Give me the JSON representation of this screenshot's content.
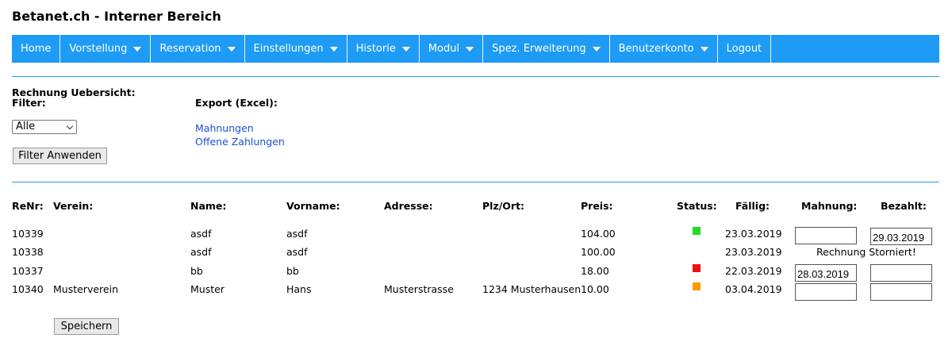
{
  "header": {
    "title": "Betanet.ch - Interner Bereich"
  },
  "nav": [
    {
      "label": "Home",
      "dropdown": false
    },
    {
      "label": "Vorstellung",
      "dropdown": true
    },
    {
      "label": "Reservation",
      "dropdown": true
    },
    {
      "label": "Einstellungen",
      "dropdown": true
    },
    {
      "label": "Historie",
      "dropdown": true
    },
    {
      "label": "Modul",
      "dropdown": true
    },
    {
      "label": "Spez. Erweiterung",
      "dropdown": true
    },
    {
      "label": "Benutzerkonto",
      "dropdown": true
    },
    {
      "label": "Logout",
      "dropdown": false
    }
  ],
  "filter": {
    "section_title": "Rechnung Uebersicht:",
    "label": "Filter:",
    "selected": "Alle",
    "apply_label": "Filter Anwenden"
  },
  "export": {
    "label": "Export (Excel):",
    "links": [
      "Mahnungen",
      "Offene Zahlungen"
    ]
  },
  "table": {
    "headers": [
      "ReNr:",
      "Verein:",
      "Name:",
      "Vorname:",
      "Adresse:",
      "Plz/Ort:",
      "Preis:",
      "Status:",
      "Fällig:",
      "Mahnung:",
      "Bezahlt:"
    ],
    "rows": [
      {
        "renr": "10339",
        "verein": "",
        "name": "asdf",
        "vorname": "asdf",
        "adresse": "",
        "plzort": "",
        "preis": "104.00",
        "status": "#22dd22",
        "faellig": "23.03.2019",
        "mahnung": "",
        "bezahlt": "29.03.2019"
      },
      {
        "renr": "10338",
        "verein": "",
        "name": "asdf",
        "vorname": "asdf",
        "adresse": "",
        "plzort": "",
        "preis": "100.00",
        "status": "",
        "faellig": "23.03.2019",
        "note": "Rechnung Storniert!"
      },
      {
        "renr": "10337",
        "verein": "",
        "name": "bb",
        "vorname": "bb",
        "adresse": "",
        "plzort": "",
        "preis": "18.00",
        "status": "#ee1111",
        "faellig": "22.03.2019",
        "mahnung": "28.03.2019",
        "bezahlt": ""
      },
      {
        "renr": "10340",
        "verein": "Musterverein",
        "name": "Muster",
        "vorname": "Hans",
        "adresse": "Musterstrasse",
        "plzort": "1234 Musterhausen",
        "preis": "10.00",
        "status": "#ff9900",
        "faellig": "03.04.2019",
        "mahnung": "",
        "bezahlt": ""
      }
    ]
  },
  "save_label": "Speichern",
  "colors": {
    "nav_bg": "#1e9bf5",
    "link": "#1a4fd6"
  }
}
